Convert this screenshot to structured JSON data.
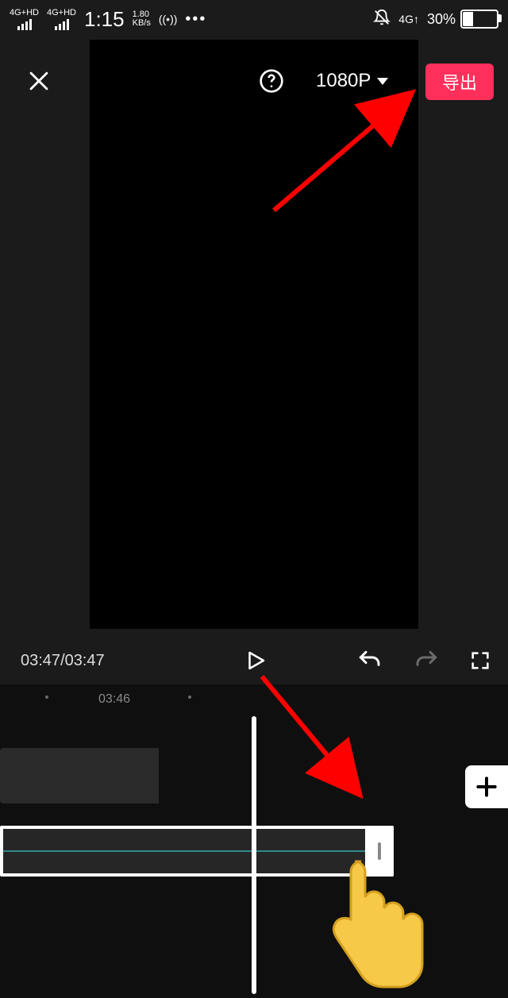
{
  "status": {
    "signal1_label": "4G+HD",
    "signal2_label": "4G+HD",
    "clock": "1:15",
    "speed_value": "1.80",
    "speed_unit": "KB/s",
    "net_indicator": "((•))",
    "more": "•••",
    "alarm_off": true,
    "data_label": "4G↑",
    "battery_pct": "30%"
  },
  "topbar": {
    "resolution": "1080P",
    "export_label": "导出"
  },
  "player": {
    "current": "03:47",
    "total": "03:47"
  },
  "timeline": {
    "ruler_label": "03:46"
  }
}
